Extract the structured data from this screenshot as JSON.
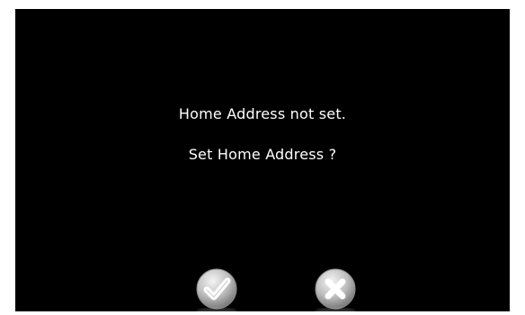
{
  "dialog": {
    "message_line1": "Home Address not set.",
    "message_line2": "Set Home Address ?"
  },
  "buttons": {
    "confirm_icon": "checkmark-icon",
    "cancel_icon": "close-icon"
  },
  "colors": {
    "background": "#000000",
    "text": "#ffffff",
    "button_face": "#c8c8c8",
    "glyph": "#ffffff"
  }
}
